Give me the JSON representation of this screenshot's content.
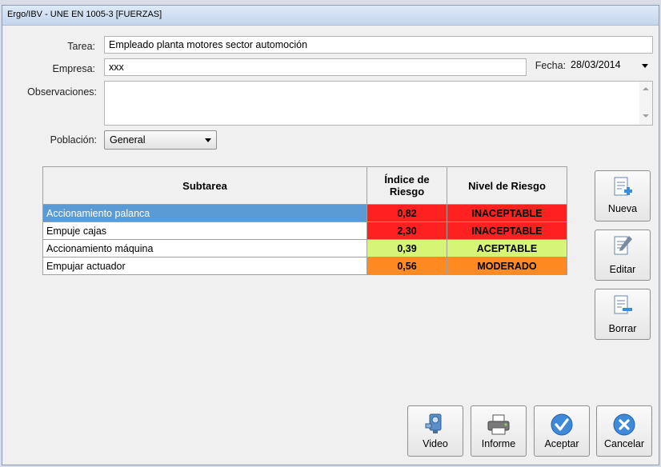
{
  "window": {
    "title": "Ergo/IBV - UNE EN 1005-3 [FUERZAS]"
  },
  "form": {
    "tarea_label": "Tarea:",
    "tarea_value": "Empleado planta motores sector automoción",
    "empresa_label": "Empresa:",
    "empresa_value": "xxx",
    "fecha_label": "Fecha:",
    "fecha_value": "28/03/2014",
    "observaciones_label": "Observaciones:",
    "observaciones_value": "",
    "poblacion_label": "Población:",
    "poblacion_value": "General"
  },
  "table": {
    "headers": [
      "Subtarea",
      "Índice de Riesgo",
      "Nivel de Riesgo"
    ],
    "rows": [
      {
        "subtarea": "Accionamiento palanca",
        "indice": "0,82",
        "nivel": "INACEPTABLE",
        "color": "#ff2020",
        "selected": true
      },
      {
        "subtarea": "Empuje cajas",
        "indice": "2,30",
        "nivel": "INACEPTABLE",
        "color": "#ff2020",
        "selected": false
      },
      {
        "subtarea": "Accionamiento máquina",
        "indice": "0,39",
        "nivel": "ACEPTABLE",
        "color": "#d6f577",
        "selected": false
      },
      {
        "subtarea": "Empujar actuador",
        "indice": "0,56",
        "nivel": "MODERADO",
        "color": "#ff8a20",
        "selected": false
      }
    ]
  },
  "side_buttons": {
    "nueva": "Nueva",
    "editar": "Editar",
    "borrar": "Borrar"
  },
  "bottom_buttons": {
    "video": "Video",
    "informe": "Informe",
    "aceptar": "Aceptar",
    "cancelar": "Cancelar"
  },
  "colors": {
    "accent": "#4a86c8",
    "selection": "#5b9bd5"
  }
}
